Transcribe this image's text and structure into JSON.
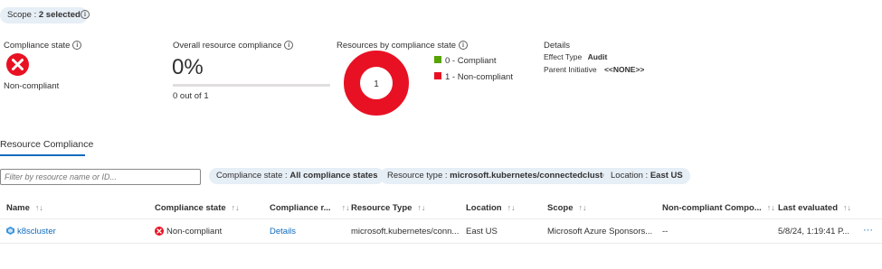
{
  "scope": {
    "label": "Scope : ",
    "value": "2 selected"
  },
  "summary": {
    "compliance_state_title": "Compliance state",
    "compliance_state_value": "Non-compliant",
    "overall_title": "Overall resource compliance",
    "overall_percent": "0%",
    "overall_fraction": 0,
    "overall_count": "0 out of 1",
    "by_state_title": "Resources by compliance state",
    "donut_center": "1",
    "legend": [
      {
        "label": "0 - Compliant",
        "color": "#57a300"
      },
      {
        "label": "1 - Non-compliant",
        "color": "#e81123"
      }
    ],
    "details_title": "Details",
    "effect_type_label": "Effect Type",
    "effect_type_value": "Audit",
    "parent_initiative_label": "Parent Initiative",
    "parent_initiative_value": "<<NONE>>"
  },
  "tab": {
    "label": "Resource Compliance"
  },
  "filter": {
    "placeholder": "Filter by resource name or ID..."
  },
  "chips": [
    {
      "label": "Compliance state : ",
      "value": "All compliance states"
    },
    {
      "label": "Resource type : ",
      "value": "microsoft.kubernetes/connectedclusters"
    },
    {
      "label": "Location : ",
      "value": "East US"
    }
  ],
  "table": {
    "columns": [
      "Name",
      "Compliance state",
      "Compliance r...",
      "Resource Type",
      "Location",
      "Scope",
      "Non-compliant Compo...",
      "Last evaluated"
    ],
    "rows": [
      {
        "name": "k8scluster",
        "compliance_state": "Non-compliant",
        "compliance_reason": "Details",
        "resource_type": "microsoft.kubernetes/conn...",
        "location": "East US",
        "scope": "Microsoft Azure Sponsors...",
        "noncompliant_components": "--",
        "last_evaluated": "5/8/24, 1:19:41 P...",
        "more": "···"
      }
    ]
  },
  "colors": {
    "accent": "#0f6cbd",
    "error": "#e81123",
    "success": "#57a300",
    "pill_bg": "#e6eef6"
  },
  "icons": {
    "info": "info-icon",
    "error": "error-circle-icon",
    "sort": "sort-arrows-icon",
    "resource": "kubernetes-cluster-icon"
  }
}
